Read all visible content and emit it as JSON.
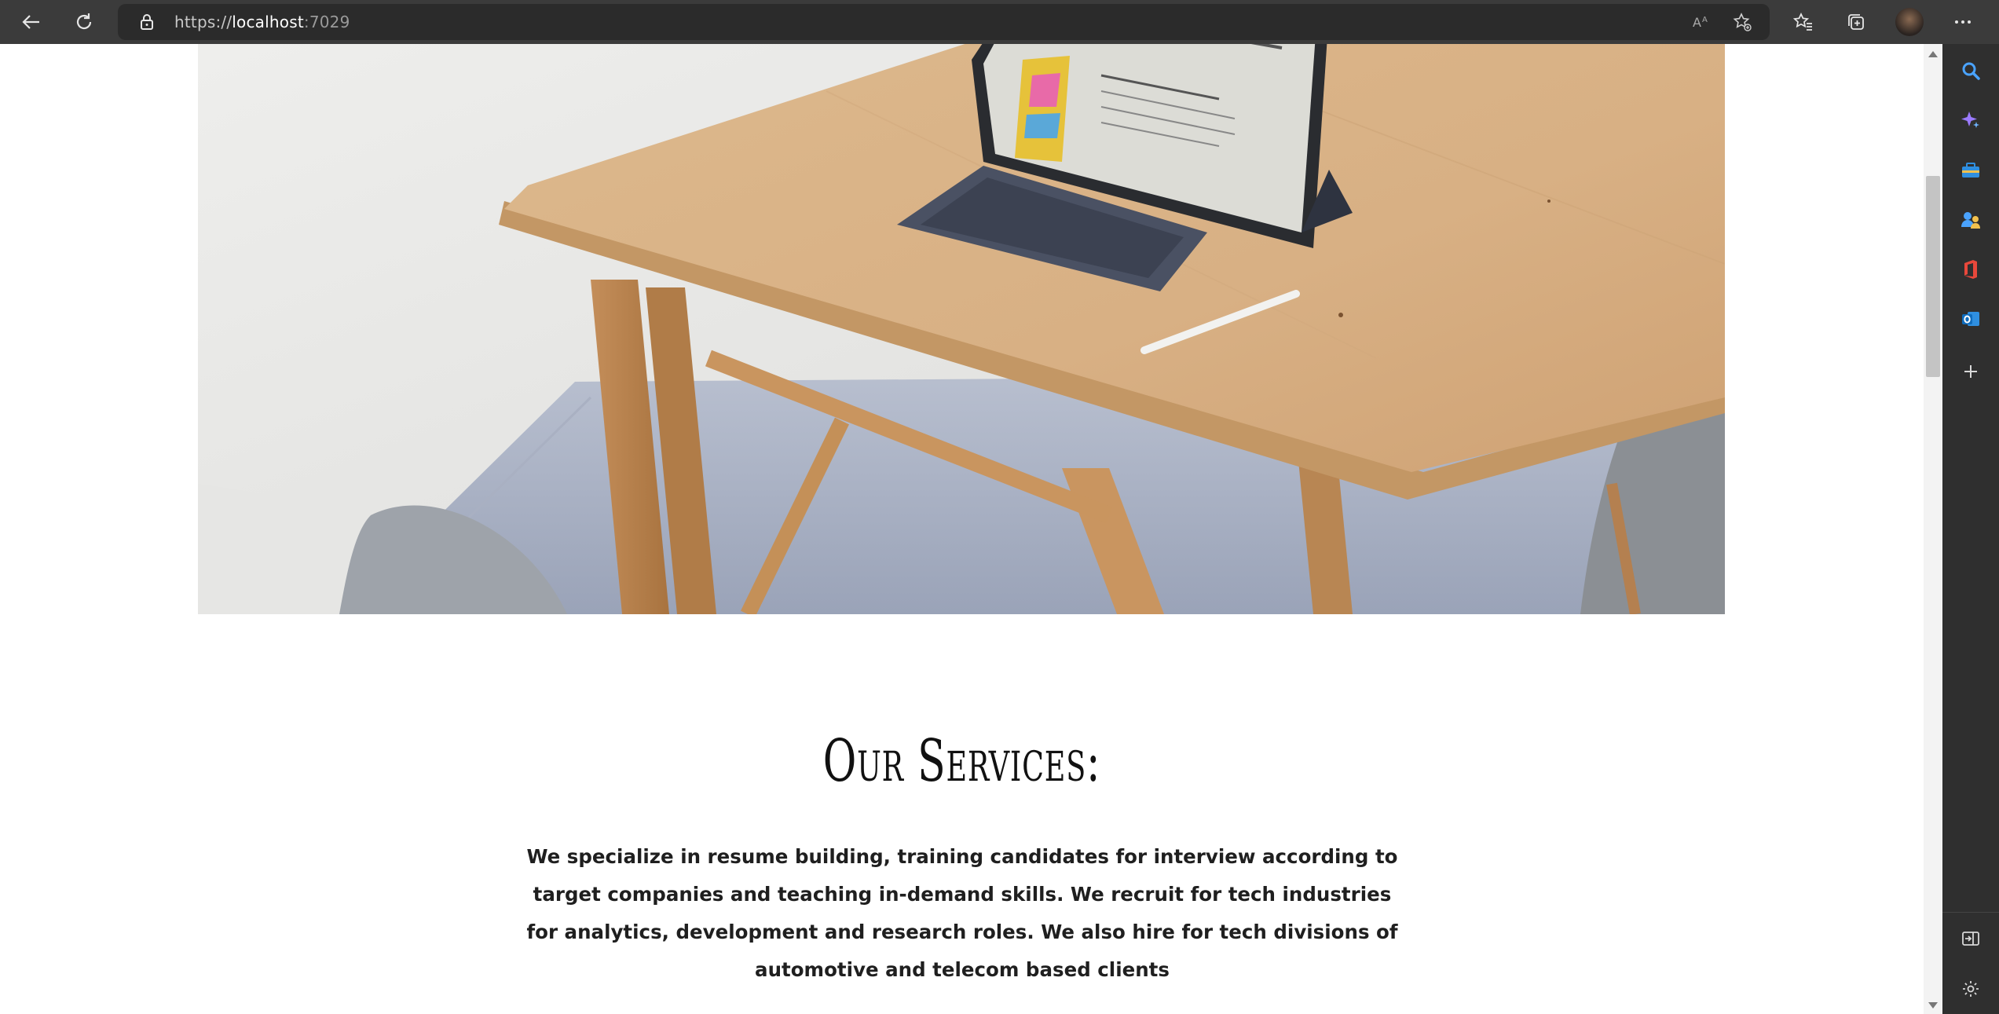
{
  "browser": {
    "url_prefix": "https://",
    "url_host": "localhost",
    "url_port": ":7029"
  },
  "icons": {
    "back": "back-arrow-icon",
    "refresh": "refresh-icon",
    "lock": "lock-icon",
    "read_aloud": "read-aloud-icon",
    "add_favorite": "star-plus-icon",
    "favorites": "favorites-icon",
    "collections": "collections-icon",
    "more": "more-icon",
    "sidebar": [
      "search-icon",
      "copilot-icon",
      "tools-icon",
      "people-icon",
      "office-icon",
      "outlook-icon",
      "add-icon",
      "hide-sidebar-icon",
      "settings-icon"
    ]
  },
  "colors": {
    "chrome_bg": "#3b3b3b",
    "address_bg": "#2b2b2b",
    "sidebar_bg": "#2f2f2f",
    "page_bg": "#ffffff",
    "text_dark": "#1f1f1f"
  },
  "hero": {
    "image": "photo-desk-tablet"
  },
  "services": {
    "title": "Our Services:",
    "body": "We specialize in resume building, training candidates for interview according to target companies and teaching in-demand skills. We recruit for tech industries for analytics, development and research roles. We also hire for tech divisions of automotive and telecom based clients"
  }
}
